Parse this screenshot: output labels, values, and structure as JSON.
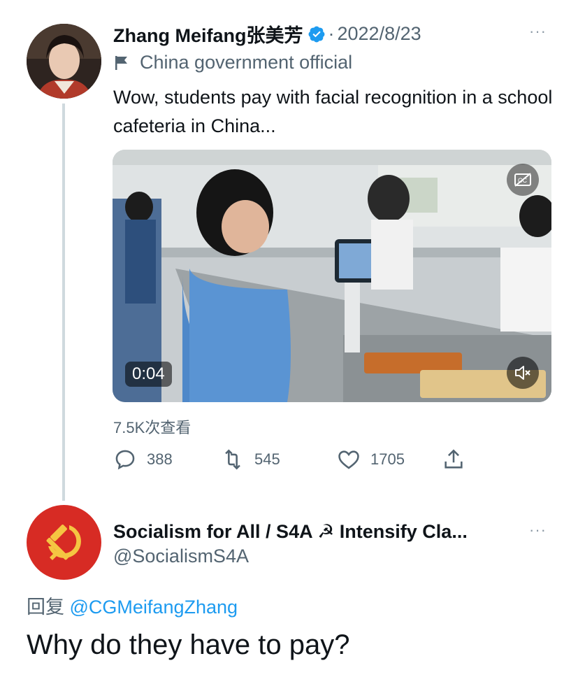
{
  "tweet1": {
    "author_name": "Zhang Meifang张美芳",
    "separator": "·",
    "date": "2022/8/23",
    "label": "China government official",
    "text": "Wow, students pay with facial recognition in a school cafeteria in China...",
    "video": {
      "timestamp": "0:04"
    },
    "views": "7.5K次查看",
    "actions": {
      "replies": "388",
      "retweets": "545",
      "likes": "1705"
    },
    "more_label": "···"
  },
  "tweet2": {
    "author_name": "Socialism for All / S4A ☭ Intensify Cla...",
    "handle": "@SocialismS4A",
    "replying_prefix": "回复",
    "replying_to": "@CGMeifangZhang",
    "text": "Why do they have to pay?",
    "more_label": "···"
  },
  "colors": {
    "verified": "#1d9bf0",
    "link": "#1d9bf0",
    "secondary_text": "#536471",
    "hammer_sickle_bg": "#d72b24",
    "hammer_sickle_fg": "#f5c542"
  },
  "icons": [
    "verified-badge-icon",
    "flag-icon",
    "closed-captions-icon",
    "mute-icon",
    "reply-icon",
    "retweet-icon",
    "like-icon",
    "share-icon",
    "hammer-and-sickle-icon"
  ]
}
